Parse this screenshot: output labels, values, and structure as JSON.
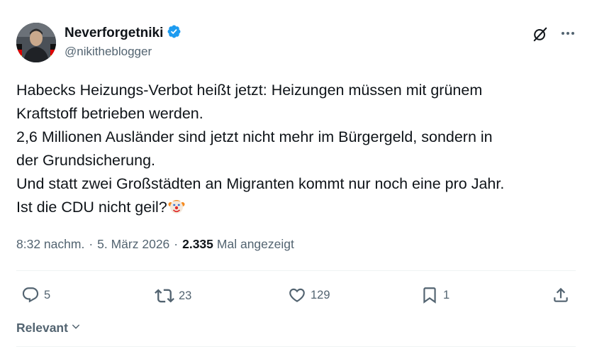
{
  "author": {
    "display_name": "Neverforgetniki",
    "handle": "@nikitheblogger",
    "verified": true
  },
  "post": {
    "lines": [
      "Habecks Heizungs-Verbot heißt jetzt: Heizungen müssen mit grünem",
      "Kraftstoff betrieben werden.",
      "2,6 Millionen Ausländer sind jetzt nicht mehr im Bürgergeld, sondern in",
      "der Grundsicherung.",
      "Und statt zwei Großstädten an Migranten kommt nur noch eine pro Jahr.",
      "Ist die CDU nicht geil?"
    ],
    "emoji": "clown-face-icon"
  },
  "meta": {
    "time": "8:32 nachm.",
    "separator": "·",
    "date": "5. März 2026",
    "views_count": "2.335",
    "views_label": "Mal angezeigt"
  },
  "actions": {
    "replies": "5",
    "reposts": "23",
    "likes": "129",
    "bookmarks": "1"
  },
  "sort": {
    "label": "Relevant"
  },
  "colors": {
    "text": "#0f1419",
    "secondary": "#536471",
    "verified": "#1d9bf0",
    "divider": "#eff3f4"
  }
}
